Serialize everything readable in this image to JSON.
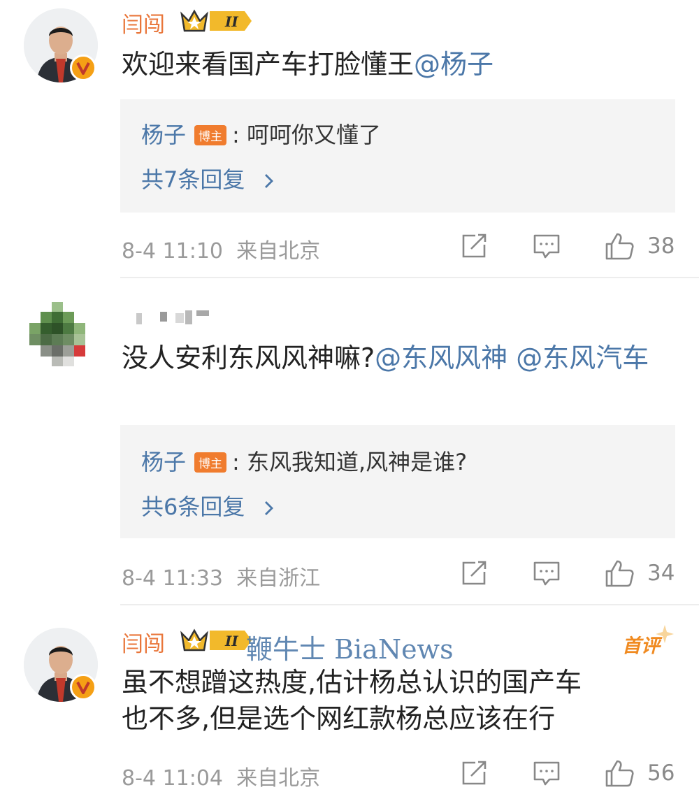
{
  "colors": {
    "accent": "#f07c2e",
    "link": "#4b77a8",
    "meta": "#9a9a9a",
    "reply_bg": "#f4f4f4"
  },
  "comments": [
    {
      "user": "闫闯",
      "level_badge": "II",
      "content_text": "欢迎来看国产车打脸懂王",
      "mentions": [
        "@杨子"
      ],
      "reply": {
        "author": "杨子",
        "tag": "博主",
        "text": "呵呵你又懂了",
        "count": "共7条回复"
      },
      "time": "8-4 11:10",
      "location": "来自北京",
      "likes": "38"
    },
    {
      "user": "",
      "content_text": "没人安利东风风神嘛?",
      "mentions": [
        "@东风风神",
        "@东风汽车"
      ],
      "reply": {
        "author": "杨子",
        "tag": "博主",
        "text": "东风我知道,风神是谁?",
        "count": "共6条回复"
      },
      "time": "8-4 11:33",
      "location": "来自浙江",
      "likes": "34"
    },
    {
      "user": "闫闯",
      "level_badge": "II",
      "first_badge": "首评",
      "content_line1": "虽不想蹭这热度,估计杨总认识的国产车",
      "content_line2": "也不多,但是选个网红款杨总应该在行",
      "time": "8-4 11:04",
      "location": "来自北京",
      "likes": "56"
    }
  ],
  "icons": [
    "repost-icon",
    "comment-icon",
    "like-icon",
    "verified-icon",
    "crown-icon",
    "chevron-right-icon"
  ],
  "watermark": "鞭牛士 BiaNews"
}
